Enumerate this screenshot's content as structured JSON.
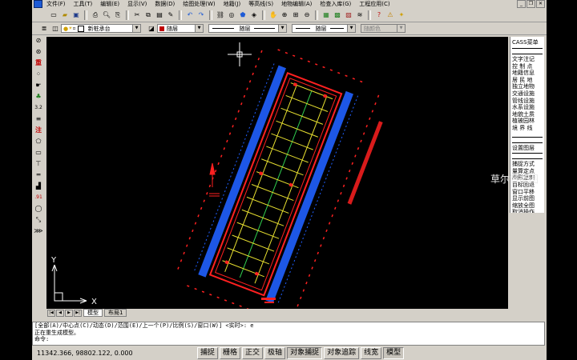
{
  "menu": {
    "items": [
      "文件(F)",
      "工具(T)",
      "编辑(E)",
      "显示(V)",
      "数据(D)",
      "绘图处理(W)",
      "地籍(J)",
      "等高线(S)",
      "地物编辑(A)",
      "检查入库(G)",
      "工程应用(C)"
    ]
  },
  "icons": {
    "toolbar": [
      "new-file-icon",
      "open-icon",
      "save-icon",
      "print-icon",
      "print-preview-icon",
      "publish-icon",
      "cut-icon",
      "copy-icon",
      "paste-icon",
      "match-prop-icon",
      "undo-icon",
      "redo-icon",
      "hyperlink-icon",
      "osnap-icon",
      "ucs-icon",
      "tracking-icon",
      "pan-icon",
      "zoom-realtime-icon",
      "zoom-window-icon",
      "zoom-previous-icon",
      "properties-icon",
      "design-center-icon",
      "tool-palette-icon",
      "layer-icon",
      "help-icon",
      "warn-icon",
      "star-icon"
    ],
    "left": [
      "pick-icon",
      "filter-icon",
      "weight-icon",
      "nodes-icon",
      "hand-icon",
      "plant-icon",
      "spot-height-icon",
      "boundary-icon",
      "annotate-icon",
      "polygon-icon",
      "rect-icon",
      "text-edit-icon",
      "line-icon",
      "stairs-icon",
      "elevation-icon",
      "circle-icon",
      "measure-icon",
      "more-icon"
    ]
  },
  "propbar": {
    "layer_name": "新桩承台",
    "color_value": "随层",
    "linetype_value": "随层",
    "lineweight_value": "随层",
    "plotstyle_value": "随颜色"
  },
  "canvas": {
    "axis_y": "Y",
    "axis_x": "X"
  },
  "layout_tabs": [
    "模型",
    "布局1"
  ],
  "right_panel": {
    "title": "CASS菜单",
    "items1": [
      "文字注记",
      "控 制 点",
      "地籍信息",
      "居 民 地",
      "独立地物",
      "交通设施",
      "管线设施",
      "水系设施",
      "境界线",
      "地貌土质",
      "植被园林"
    ],
    "item_last1": "境 界 线",
    "grip_label": "设置图层",
    "items2": [
      "捕捉方式",
      "量算定点",
      "图形复制",
      "目标回退",
      "窗口平移",
      "显示前图",
      "缩放全图",
      "取消操作"
    ]
  },
  "overlay_text": "草尔智能图",
  "command": {
    "line1": "[全部(A)/中心点(C)/动态(D)/范围(E)/上一个(P)/比例(S)/窗口(W)] <实时>: e",
    "line2": "正在重生成模型。",
    "line3": "命令:"
  },
  "status": {
    "coords": "11342.366, 98802.122, 0.000",
    "buttons": [
      "捕捉",
      "栅格",
      "正交",
      "极轴",
      "对象捕捉",
      "对象追踪",
      "线宽",
      "模型"
    ]
  },
  "colors": {
    "accent_blue": "#1e5bd6",
    "red": "#ff2020",
    "yellow": "#e8e030",
    "blue_tree": "#2060ff",
    "green": "#30d050"
  }
}
